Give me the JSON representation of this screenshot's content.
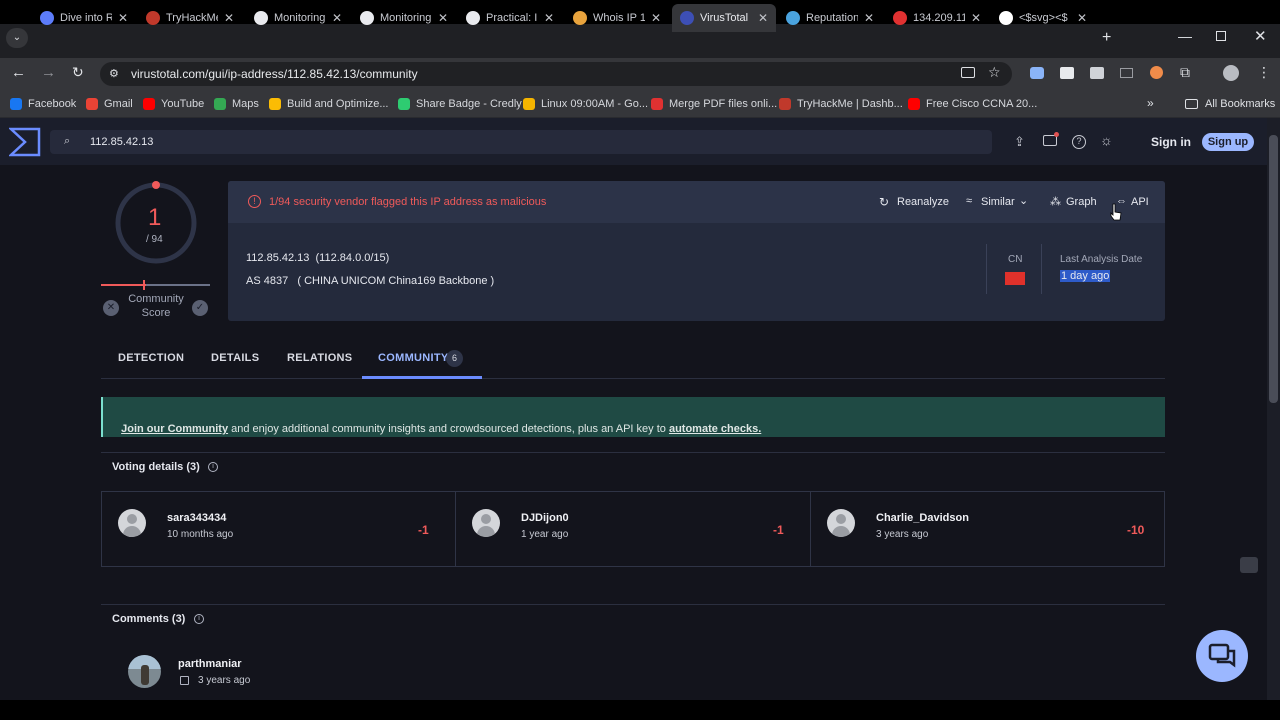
{
  "browser": {
    "tabs": [
      {
        "title": "Dive into R",
        "fav_color": "#5c7cfa"
      },
      {
        "title": "TryHackMe",
        "fav_color": "#c0392b"
      },
      {
        "title": "Monitoring",
        "fav_color": "#e9eaee"
      },
      {
        "title": "Monitoring",
        "fav_color": "#e9eaee"
      },
      {
        "title": "Practical: I",
        "fav_color": "#e9eaee"
      },
      {
        "title": "Whois IP 1",
        "fav_color": "#e8a33d"
      },
      {
        "title": "VirusTotal",
        "fav_color": "#3d4fb5"
      },
      {
        "title": "Reputation",
        "fav_color": "#4aa3df"
      },
      {
        "title": "134.209.11",
        "fav_color": "#e03131"
      },
      {
        "title": "<$svg><$",
        "fav_color": "#ffffff"
      }
    ],
    "new_tab": "+",
    "url": "virustotal.com/gui/ip-address/112.85.42.13/community",
    "bookmarks": [
      {
        "label": "Facebook",
        "color": "#1877f2"
      },
      {
        "label": "Gmail",
        "color": "#ea4335"
      },
      {
        "label": "YouTube",
        "color": "#ff0000"
      },
      {
        "label": "Maps",
        "color": "#34a853"
      },
      {
        "label": "Build and Optimize...",
        "color": "#fbbc04"
      },
      {
        "label": "Share Badge - Credly",
        "color": "#2ecc71"
      },
      {
        "label": "Linux 09:00AM - Go...",
        "color": "#f4b400"
      },
      {
        "label": "Merge PDF files onli...",
        "color": "#e03131"
      },
      {
        "label": "TryHackMe | Dashb...",
        "color": "#c0392b"
      },
      {
        "label": "Free Cisco CCNA 20...",
        "color": "#ff0000"
      }
    ],
    "bookmarks_more": "»",
    "all_bookmarks": "All Bookmarks"
  },
  "vt": {
    "search_value": "112.85.42.13",
    "sign_in": "Sign in",
    "sign_up": "Sign up",
    "score_value": "1",
    "score_total": "/ 94",
    "community_score_line1": "Community",
    "community_score_line2": "Score",
    "alert": "1/94 security vendor flagged this IP address as malicious",
    "actions": {
      "reanalyze": "Reanalyze",
      "similar": "Similar",
      "graph": "Graph",
      "api": "API"
    },
    "ip_line": "112.85.42.13  (112.84.0.0/15)",
    "as_line": "AS 4837   ( CHINA UNICOM China169 Backbone )",
    "country_code": "CN",
    "last_analysis_label": "Last Analysis Date",
    "last_analysis_value": "1 day ago",
    "nav": {
      "detection": "DETECTION",
      "details": "DETAILS",
      "relations": "RELATIONS",
      "community": "COMMUNITY",
      "community_count": "6"
    },
    "banner": {
      "link1": "Join our Community",
      "middle": " and enjoy additional community insights and crowdsourced detections, plus an API key to ",
      "link2": "automate checks."
    },
    "voting_title": "Voting details",
    "voting_count": "(3)",
    "votes": [
      {
        "user": "sara343434",
        "time": "10 months ago",
        "score": "-1"
      },
      {
        "user": "DJDijon0",
        "time": "1 year ago",
        "score": "-1"
      },
      {
        "user": "Charlie_Davidson",
        "time": "3 years ago",
        "score": "-10"
      }
    ],
    "comments_title": "Comments",
    "comments_count": "(3)",
    "comment_user": "parthmaniar",
    "comment_time": "3 years ago"
  }
}
